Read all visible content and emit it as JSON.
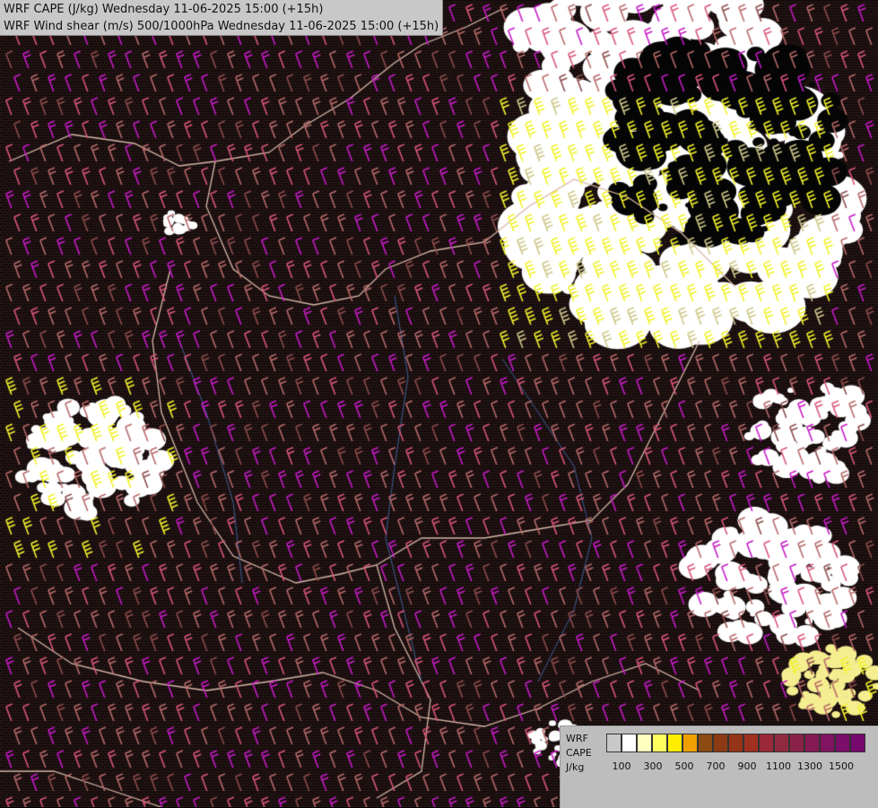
{
  "header": {
    "line1": "WRF CAPE (J/kg) Wednesday 11-06-2025 15:00 (+15h)",
    "line2": "WRF Wind shear (m/s) 500/1000hPa Wednesday 11-06-2025 15:00 (+15h)"
  },
  "legend": {
    "model": "WRF",
    "field": "CAPE",
    "unit": "J/kg",
    "colors": [
      "#c8c8c8",
      "#ffffff",
      "#ffffc0",
      "#ffff60",
      "#ffee00",
      "#f0a000",
      "#8a4a10",
      "#8c3a14",
      "#963418",
      "#a03020",
      "#9a2838",
      "#902a40",
      "#8a2248",
      "#861a54",
      "#801460",
      "#7a0e6a",
      "#76086e"
    ],
    "tick_labels": [
      "100",
      "300",
      "500",
      "700",
      "900",
      "1100",
      "1300",
      "1500"
    ]
  },
  "map": {
    "background": "#2a1c1c",
    "barb_colors": [
      "#c71bc7",
      "#d9567a",
      "#b86a6a",
      "#e8e830",
      "#8e4c4c"
    ],
    "border_color": "#d8b8a8",
    "river_color": "#4a6aa0"
  }
}
